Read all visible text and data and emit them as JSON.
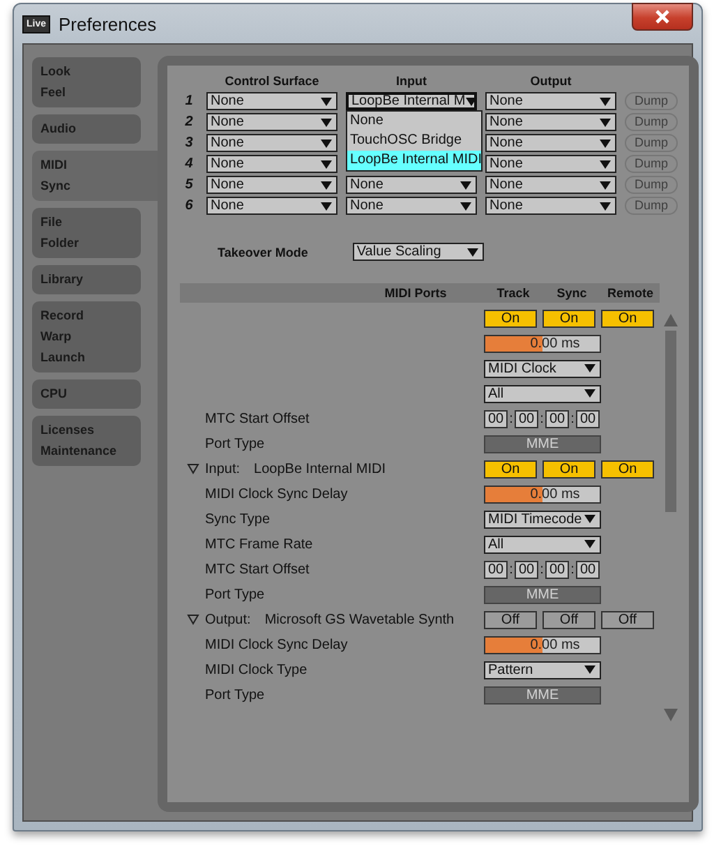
{
  "window": {
    "title": "Preferences",
    "app_badge": "Live"
  },
  "sidebar": {
    "tabs": [
      {
        "lines": [
          "Look",
          "Feel"
        ],
        "selected": false
      },
      {
        "lines": [
          "Audio"
        ],
        "selected": false
      },
      {
        "lines": [
          "MIDI",
          "Sync"
        ],
        "selected": true
      },
      {
        "lines": [
          "File",
          "Folder"
        ],
        "selected": false
      },
      {
        "lines": [
          "Library"
        ],
        "selected": false
      },
      {
        "lines": [
          "Record",
          "Warp",
          "Launch"
        ],
        "selected": false
      },
      {
        "lines": [
          "CPU"
        ],
        "selected": false
      },
      {
        "lines": [
          "Licenses",
          "Maintenance"
        ],
        "selected": false
      }
    ]
  },
  "control_surfaces": {
    "columns": [
      "Control Surface",
      "Input",
      "Output"
    ],
    "rows": [
      {
        "number": "1",
        "control_surface": "None",
        "input": "LoopBe Internal M",
        "input_open": true,
        "output": "None",
        "dump": "Dump",
        "dump_disabled": true
      },
      {
        "number": "2",
        "control_surface": "None",
        "output": "None",
        "dump": "Dump",
        "dump_disabled": true
      },
      {
        "number": "3",
        "control_surface": "None",
        "output": "None",
        "dump": "Dump",
        "dump_disabled": true
      },
      {
        "number": "4",
        "control_surface": "None",
        "output": "None",
        "dump": "Dump",
        "dump_disabled": true
      },
      {
        "number": "5",
        "control_surface": "None",
        "input": "None",
        "input_open": false,
        "output": "None",
        "dump": "Dump",
        "dump_disabled": true
      },
      {
        "number": "6",
        "control_surface": "None",
        "input": "None",
        "input_open": false,
        "output": "None",
        "dump": "Dump",
        "dump_disabled": true
      }
    ],
    "input_menu": [
      {
        "label": "None",
        "selected": false
      },
      {
        "label": "TouchOSC Bridge",
        "selected": false
      },
      {
        "label": "LoopBe Internal MIDI",
        "selected": true
      }
    ],
    "takeover": {
      "label": "Takeover Mode",
      "value": "Value Scaling"
    }
  },
  "midi_ports": {
    "columns": [
      "MIDI Ports",
      "Track",
      "Sync",
      "Remote"
    ],
    "rows": [
      {
        "kind": "port",
        "toggles": [
          {
            "label": "On",
            "on": true
          },
          {
            "label": "On",
            "on": true
          },
          {
            "label": "On",
            "on": true
          }
        ]
      },
      {
        "kind": "delay",
        "value": "0.00 ms",
        "level": 0.5
      },
      {
        "kind": "dropdown",
        "value": "MIDI Clock"
      },
      {
        "kind": "dropdown",
        "value": "All"
      },
      {
        "kind": "offset",
        "label": "MTC Start Offset",
        "parts": [
          {
            "kind": "field",
            "text": "00"
          },
          {
            "kind": "sep",
            "text": ":"
          },
          {
            "kind": "field",
            "text": "00"
          },
          {
            "kind": "sep",
            "text": ":"
          },
          {
            "kind": "field",
            "text": "00"
          },
          {
            "kind": "sep",
            "text": ":"
          },
          {
            "kind": "field",
            "text": "00"
          }
        ]
      },
      {
        "kind": "port_type",
        "label": "Port Type",
        "value": "MME"
      },
      {
        "kind": "port",
        "expanded": true,
        "direction": "Input:",
        "label": "LoopBe Internal MIDI",
        "toggles": [
          {
            "label": "On",
            "on": true
          },
          {
            "label": "On",
            "on": true
          },
          {
            "label": "On",
            "on": true
          }
        ]
      },
      {
        "kind": "delay",
        "label": "MIDI Clock Sync Delay",
        "value": "0.00 ms",
        "level": 0.5
      },
      {
        "kind": "dropdown",
        "label": "Sync Type",
        "value": "MIDI Timecode"
      },
      {
        "kind": "dropdown",
        "label": "MTC Frame Rate",
        "value": "All"
      },
      {
        "kind": "offset",
        "label": "MTC Start Offset",
        "parts": [
          {
            "kind": "field",
            "text": "00"
          },
          {
            "kind": "sep",
            "text": ":"
          },
          {
            "kind": "field",
            "text": "00"
          },
          {
            "kind": "sep",
            "text": ":"
          },
          {
            "kind": "field",
            "text": "00"
          },
          {
            "kind": "sep",
            "text": ":"
          },
          {
            "kind": "field",
            "text": "00"
          }
        ]
      },
      {
        "kind": "port_type",
        "label": "Port Type",
        "value": "MME"
      },
      {
        "kind": "port",
        "expanded": true,
        "direction": "Output:",
        "label": "Microsoft GS Wavetable Synth",
        "toggles": [
          {
            "label": "Off",
            "on": false
          },
          {
            "label": "Off",
            "on": false
          },
          {
            "label": "Off",
            "on": false
          }
        ]
      },
      {
        "kind": "delay",
        "label": "MIDI Clock Sync Delay",
        "value": "0.00 ms",
        "level": 0.5
      },
      {
        "kind": "dropdown",
        "label": "MIDI Clock Type",
        "value": "Pattern"
      },
      {
        "kind": "port_type",
        "label": "Port Type",
        "value": "MME"
      }
    ]
  }
}
